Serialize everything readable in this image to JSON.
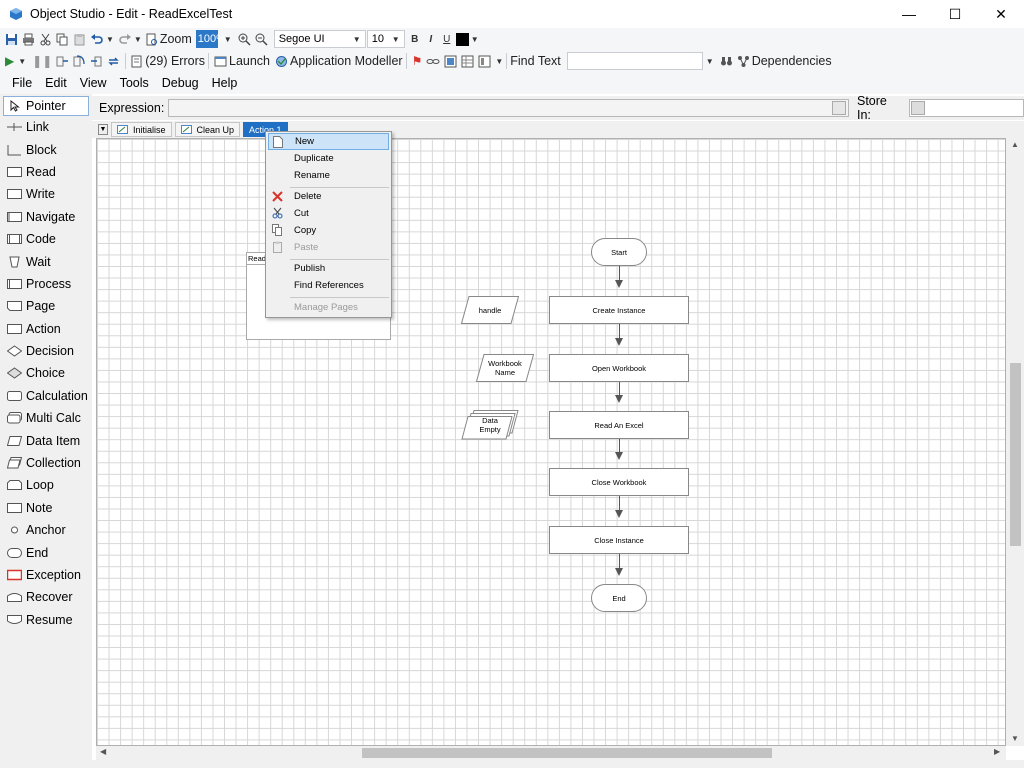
{
  "window": {
    "title": "Object Studio  - Edit - ReadExcelTest",
    "minimize": "—",
    "maximize": "☐",
    "close": "✕"
  },
  "toolbar": {
    "zoom_label": "Zoom",
    "zoom_value": "100%",
    "font_name": "Segoe UI",
    "font_size": "10",
    "bold": "B",
    "italic": "I",
    "underline": "U",
    "errors_label": "(29) Errors",
    "launch_label": "Launch",
    "app_modeller_label": "Application Modeller",
    "find_text_label": "Find Text",
    "find_text_value": "",
    "dependencies_label": "Dependencies"
  },
  "menu": [
    "File",
    "Edit",
    "View",
    "Tools",
    "Debug",
    "Help"
  ],
  "palette": [
    {
      "name": "pointer",
      "label": "Pointer"
    },
    {
      "name": "link",
      "label": "Link"
    },
    {
      "name": "block",
      "label": "Block"
    },
    {
      "name": "read",
      "label": "Read"
    },
    {
      "name": "write",
      "label": "Write"
    },
    {
      "name": "navigate",
      "label": "Navigate"
    },
    {
      "name": "code",
      "label": "Code"
    },
    {
      "name": "wait",
      "label": "Wait"
    },
    {
      "name": "process",
      "label": "Process"
    },
    {
      "name": "page",
      "label": "Page"
    },
    {
      "name": "action",
      "label": "Action"
    },
    {
      "name": "decision",
      "label": "Decision"
    },
    {
      "name": "choice",
      "label": "Choice"
    },
    {
      "name": "calculation",
      "label": "Calculation"
    },
    {
      "name": "multi-calc",
      "label": "Multi Calc"
    },
    {
      "name": "data-item",
      "label": "Data Item"
    },
    {
      "name": "collection",
      "label": "Collection"
    },
    {
      "name": "loop",
      "label": "Loop"
    },
    {
      "name": "note",
      "label": "Note"
    },
    {
      "name": "anchor",
      "label": "Anchor"
    },
    {
      "name": "end",
      "label": "End"
    },
    {
      "name": "exception",
      "label": "Exception"
    },
    {
      "name": "recover",
      "label": "Recover"
    },
    {
      "name": "resume",
      "label": "Resume"
    }
  ],
  "expression": {
    "label": "Expression:",
    "value": "",
    "store_in_label": "Store In:",
    "store_in_value": ""
  },
  "tabs": [
    {
      "label": "Initialise",
      "active": false
    },
    {
      "label": "Clean Up",
      "active": false
    },
    {
      "label": "Action 1",
      "active": true
    }
  ],
  "context_menu": {
    "items": [
      {
        "label": "New",
        "highlighted": true,
        "disabled": false,
        "icon": "page-icon"
      },
      {
        "label": "Duplicate",
        "highlighted": false,
        "disabled": false,
        "icon": ""
      },
      {
        "label": "Rename",
        "highlighted": false,
        "disabled": false,
        "icon": ""
      },
      {
        "label": "Delete",
        "highlighted": false,
        "disabled": false,
        "icon": "delete-x-icon"
      },
      {
        "label": "Cut",
        "highlighted": false,
        "disabled": false,
        "icon": "scissors-icon"
      },
      {
        "label": "Copy",
        "highlighted": false,
        "disabled": false,
        "icon": "copy-icon"
      },
      {
        "label": "Paste",
        "highlighted": false,
        "disabled": true,
        "icon": "paste-icon"
      },
      {
        "label": "Publish",
        "highlighted": false,
        "disabled": false,
        "icon": ""
      },
      {
        "label": "Find References",
        "highlighted": false,
        "disabled": false,
        "icon": ""
      },
      {
        "label": "Manage Pages",
        "highlighted": false,
        "disabled": true,
        "icon": ""
      }
    ]
  },
  "flow": {
    "page_box_label": "Read",
    "start": "Start",
    "end": "End",
    "steps": [
      "Create Instance",
      "Open Workbook",
      "Read An Excel",
      "Close Workbook",
      "Close Instance"
    ],
    "data_items": [
      {
        "label_line1": "handle",
        "label_line2": ""
      },
      {
        "label_line1": "Workbook",
        "label_line2": "Name"
      },
      {
        "label_line1": "Data",
        "label_line2": "Empty"
      }
    ]
  },
  "colors": {
    "tab_active": "#1f6fc5",
    "menu_highlight": "#cde3f7",
    "delete_red": "#d9342b",
    "exception_red": "#d9342b"
  }
}
